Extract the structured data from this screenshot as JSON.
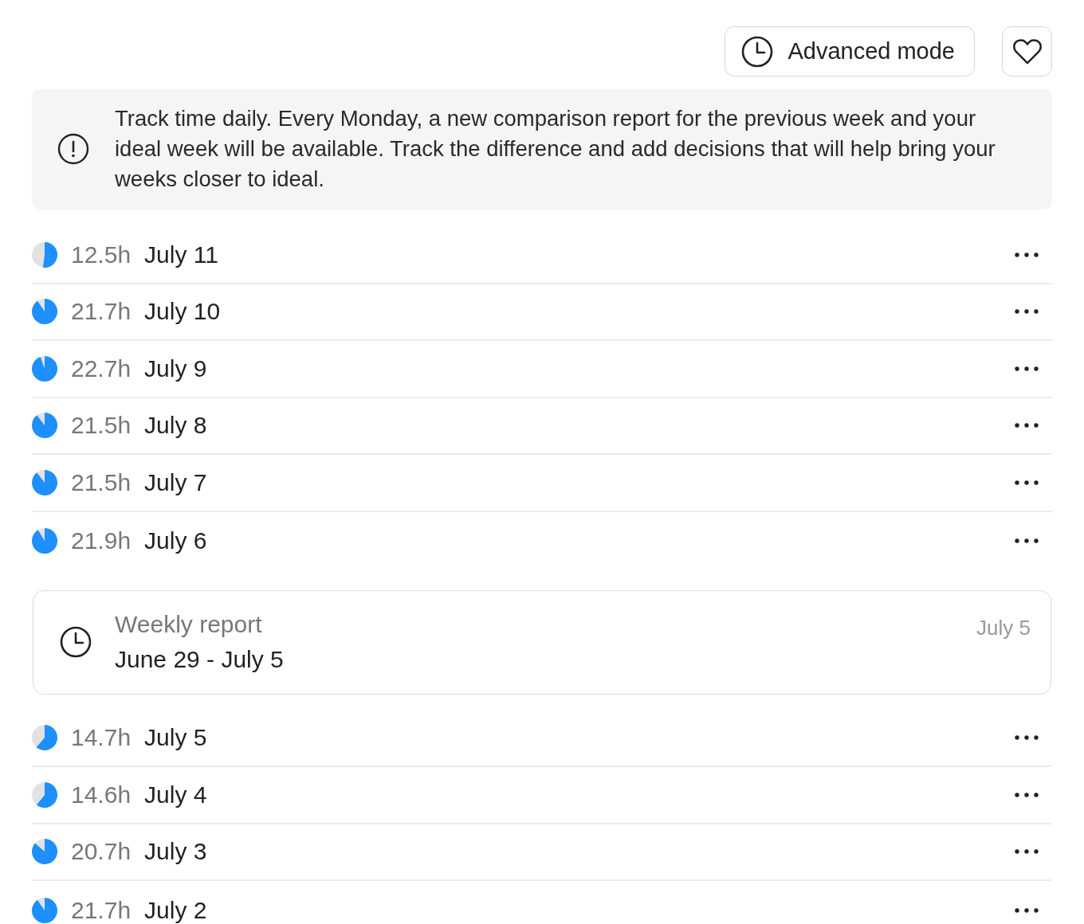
{
  "toolbar": {
    "mode_button": "Advanced mode"
  },
  "notice": {
    "text": "Track time daily. Every Monday, a new comparison report for the previous week and your ideal week will be available. Track the difference and add decisions that will help bring your weeks closer to ideal."
  },
  "feed": [
    {
      "kind": "day",
      "hours": "12.5h",
      "date": "July 11"
    },
    {
      "kind": "day",
      "hours": "21.7h",
      "date": "July 10"
    },
    {
      "kind": "day",
      "hours": "22.7h",
      "date": "July 9"
    },
    {
      "kind": "day",
      "hours": "21.5h",
      "date": "July 8"
    },
    {
      "kind": "day",
      "hours": "21.5h",
      "date": "July 7"
    },
    {
      "kind": "day",
      "hours": "21.9h",
      "date": "July 6"
    },
    {
      "kind": "report",
      "title": "Weekly report",
      "range": "June 29 - July 5",
      "date": "July 5"
    },
    {
      "kind": "day",
      "hours": "14.7h",
      "date": "July 5"
    },
    {
      "kind": "day",
      "hours": "14.6h",
      "date": "July 4"
    },
    {
      "kind": "day",
      "hours": "20.7h",
      "date": "July 3"
    },
    {
      "kind": "day",
      "hours": "21.7h",
      "date": "July 2"
    }
  ]
}
